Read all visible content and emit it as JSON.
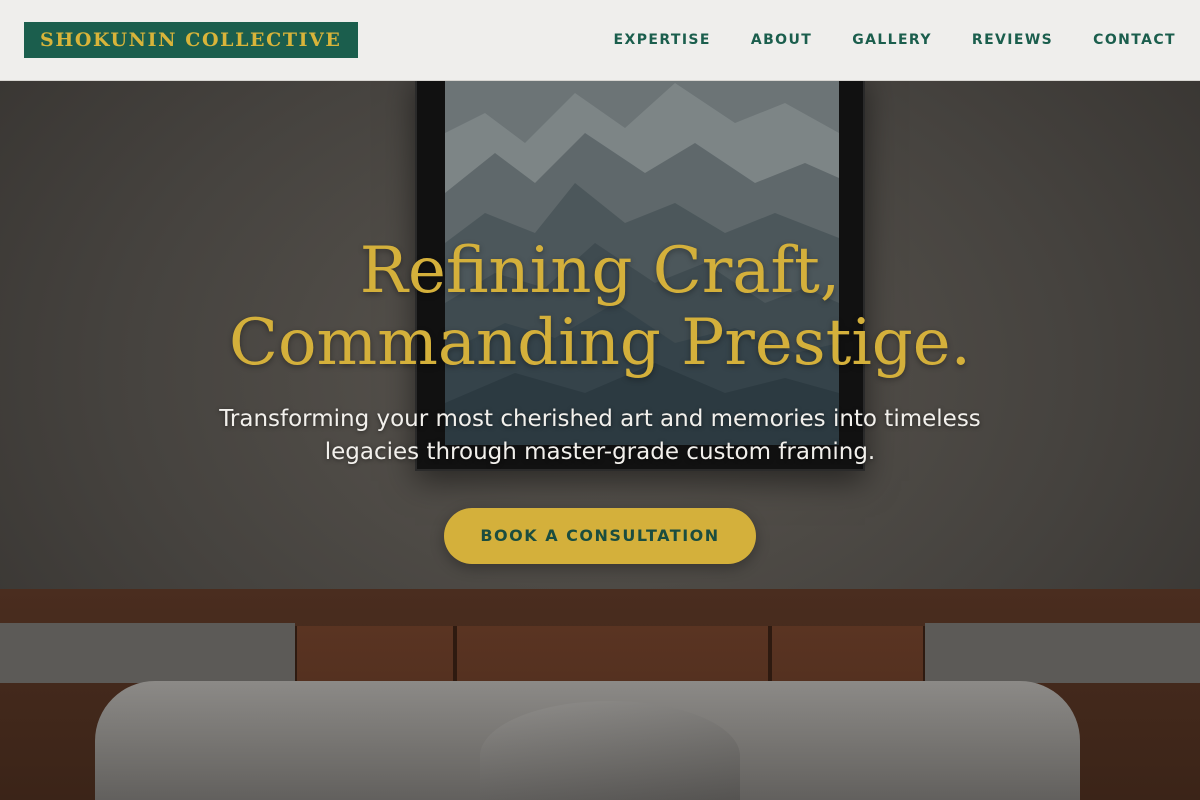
{
  "header": {
    "logo_text": "SHOKUNIN COLLECTIVE",
    "nav": [
      {
        "label": "EXPERTISE"
      },
      {
        "label": "ABOUT"
      },
      {
        "label": "GALLERY"
      },
      {
        "label": "REVIEWS"
      },
      {
        "label": "CONTACT"
      }
    ]
  },
  "hero": {
    "title": "Refining Craft, Commanding Prestige.",
    "subtitle": "Transforming your most cherished art and memories into timeless legacies through master-grade custom framing.",
    "cta_label": "BOOK A CONSULTATION"
  },
  "colors": {
    "brand_green": "#1b5e4d",
    "gold": "#d4b03b",
    "header_bg": "#efeeec"
  }
}
